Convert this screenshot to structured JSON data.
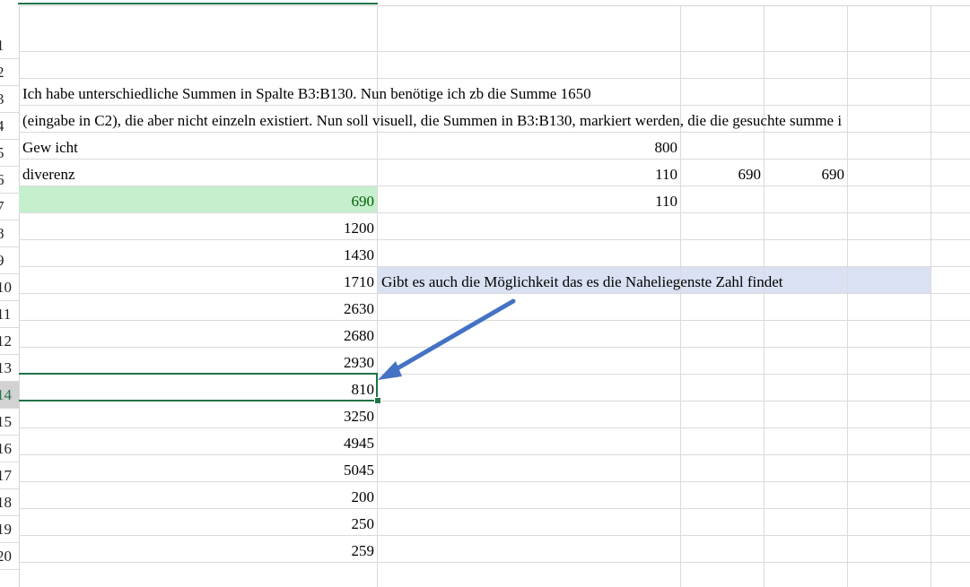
{
  "rows": [
    "1",
    "2",
    "3",
    "4",
    "5",
    "6",
    "7",
    "8",
    "9",
    "10",
    "11",
    "12",
    "13",
    "14",
    "15",
    "16",
    "17",
    "18",
    "19",
    "20"
  ],
  "selected_row": "14",
  "texts": {
    "r3": "Ich habe unterschiedliche Summen in Spalte B3:B130. Nun benötige ich zb die Summe 1650",
    "r4": "(eingabe in C2), die aber nicht einzeln existiert. Nun soll visuell, die Summen in B3:B130, markiert werden, die die gesuchte summe i",
    "r5": "Gew icht",
    "r6": "diverenz",
    "r10_note": "Gibt es auch die Möglichkeit das es die Naheliegenste Zahl findet"
  },
  "col_b": [
    "690",
    "1200",
    "1430",
    "1710",
    "2630",
    "2680",
    "2930",
    "810",
    "3250",
    "4945",
    "5045",
    "200",
    "250",
    "259"
  ],
  "col_d": {
    "r5": "800",
    "r6": "110",
    "r7": "110"
  },
  "col_e": {
    "r6": "690"
  },
  "col_f": {
    "r6": "690"
  },
  "colors": {
    "highlight_green_bg": "#c6efce",
    "highlight_green_text": "#006100",
    "note_bg": "#d9e1f2",
    "selection": "#217346",
    "arrow": "#4472c4"
  }
}
